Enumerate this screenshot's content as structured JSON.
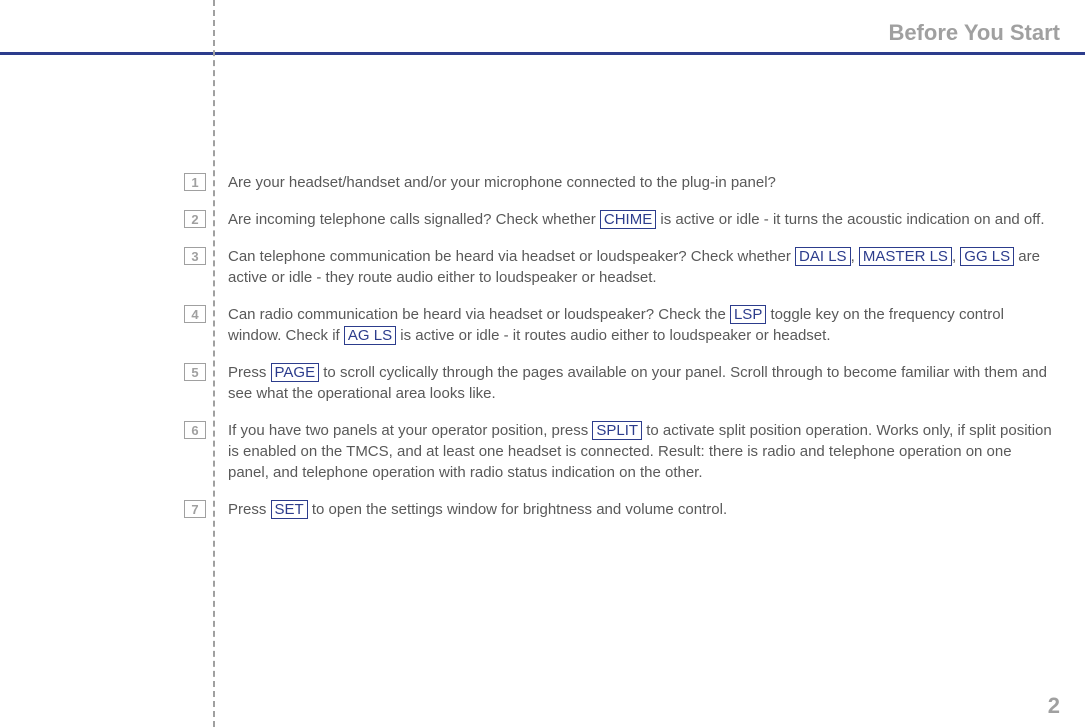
{
  "header": {
    "title": "Before You Start",
    "pageNumber": "2"
  },
  "keys": {
    "chime": "CHIME",
    "daiLs": "DAI LS",
    "masterLs": "MASTER LS",
    "ggLs": "GG LS",
    "lsp": "LSP",
    "agLs": "AG LS",
    "page": "PAGE",
    "split": "SPLIT",
    "set": "SET"
  },
  "items": [
    {
      "num": "1",
      "t1": "Are your headset/handset and/or your microphone connected to the plug-in panel?"
    },
    {
      "num": "2",
      "t1": "Are incoming telephone calls signalled? Check whether ",
      "t2": " is active or idle - it turns the acoustic indication on and off."
    },
    {
      "num": "3",
      "t1": "Can telephone communication be heard via headset or loudspeaker? Check whether ",
      "t2": ", ",
      "t3": ", ",
      "t4": " are active or idle - they route audio either to loudspeaker or headset."
    },
    {
      "num": "4",
      "t1": "Can radio communication be heard via headset or loudspeaker? Check the ",
      "t2": " toggle key on the frequency control window. Check if ",
      "t3": " is active or idle - it routes audio either to loudspeaker or headset."
    },
    {
      "num": "5",
      "t1": "Press ",
      "t2": " to scroll cyclically through the pages available on your panel. Scroll through to become familiar with them and see what the operational area looks like."
    },
    {
      "num": "6",
      "t1": "If you have two panels at your operator position, press ",
      "t2": " to activate split position operation. Works only, if split position is enabled on the TMCS, and at least one headset is connected. Result: there is radio and telephone operation on one panel, and telephone operation with radio status indication on the other."
    },
    {
      "num": "7",
      "t1": "Press ",
      "t2": " to open the settings window for brightness and volume control."
    }
  ]
}
